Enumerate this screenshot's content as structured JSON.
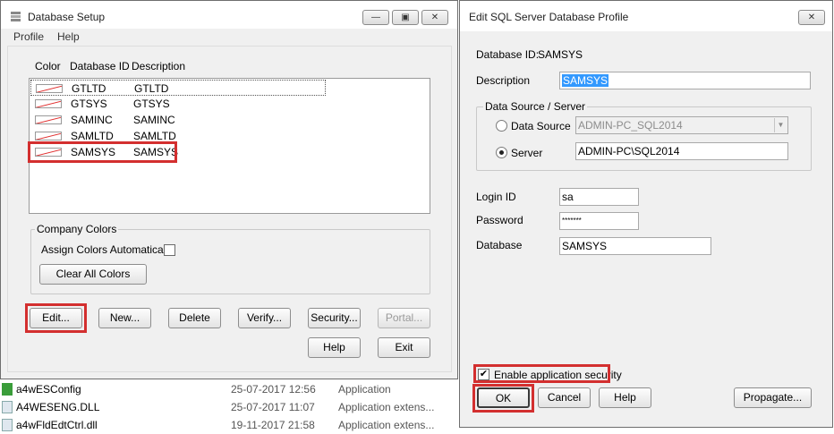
{
  "left_window": {
    "title": "Database Setup",
    "menu": [
      "Profile",
      "Help"
    ],
    "columns": {
      "color": "Color",
      "id": "Database ID",
      "desc": "Description"
    },
    "rows": [
      {
        "id": "GTLTD",
        "desc": "GTLTD"
      },
      {
        "id": "GTSYS",
        "desc": "GTSYS"
      },
      {
        "id": "SAMINC",
        "desc": "SAMINC"
      },
      {
        "id": "SAMLTD",
        "desc": "SAMLTD"
      },
      {
        "id": "SAMSYS",
        "desc": "SAMSYS"
      }
    ],
    "company_colors": {
      "legend": "Company Colors",
      "assign_label": "Assign Colors Automatically",
      "clear_label": "Clear All Colors"
    },
    "buttons": {
      "edit": "Edit...",
      "new": "New...",
      "delete": "Delete",
      "verify": "Verify...",
      "security": "Security...",
      "portal": "Portal...",
      "help": "Help",
      "exit": "Exit"
    }
  },
  "right_window": {
    "title": "Edit SQL Server Database Profile",
    "database_id_label": "Database ID:",
    "database_id_value": "SAMSYS",
    "description_label": "Description",
    "description_value": "SAMSYS",
    "datasource_group": "Data Source / Server",
    "datasource_label": "Data Source",
    "datasource_value": "ADMIN-PC_SQL2014",
    "server_label": "Server",
    "server_value": "ADMIN-PC\\SQL2014",
    "login_label": "Login ID",
    "login_value": "sa",
    "password_label": "Password",
    "password_value": "*******",
    "database_label": "Database",
    "database_value": "SAMSYS",
    "security_label": "Enable application security",
    "buttons": {
      "ok": "OK",
      "cancel": "Cancel",
      "help": "Help",
      "propagate": "Propagate..."
    }
  },
  "file_list": [
    {
      "name": "a4wESConfig",
      "date": "25-07-2017 12:56",
      "type": "Application"
    },
    {
      "name": "A4WESENG.DLL",
      "date": "25-07-2017 11:07",
      "type": "Application extens..."
    },
    {
      "name": "a4wFldEdtCtrl.dll",
      "date": "19-11-2017 21:58",
      "type": "Application extens..."
    }
  ],
  "colors": {
    "highlight": "#d32f2f",
    "selection": "#3399ff"
  }
}
